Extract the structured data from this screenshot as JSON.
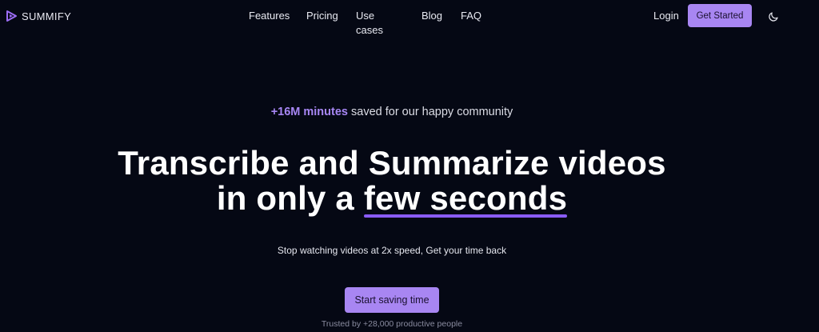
{
  "brand": {
    "name": "SUMMIFY",
    "icon": "play-logo-icon"
  },
  "nav": {
    "items": [
      {
        "label": "Features"
      },
      {
        "label": "Pricing"
      },
      {
        "label": "Use cases"
      },
      {
        "label": "Blog"
      },
      {
        "label": "FAQ"
      }
    ]
  },
  "header": {
    "login_label": "Login",
    "get_started_label": "Get Started",
    "theme_icon": "moon-icon"
  },
  "hero": {
    "tagline_highlight": "+16M minutes",
    "tagline_rest": " saved for our happy community",
    "headline_line1": "Transcribe and Summarize videos",
    "headline_line2_prefix": "in only a ",
    "headline_line2_underlined": "few seconds",
    "subtitle": "Stop watching videos at 2x speed, Get your time back",
    "cta_label": "Start saving time",
    "trusted_text": "Trusted by +28,000 productive people"
  },
  "colors": {
    "background": "#050814",
    "accent": "#a886f2",
    "underline": "#8a5cf6",
    "highlight_text": "#a887f5"
  }
}
